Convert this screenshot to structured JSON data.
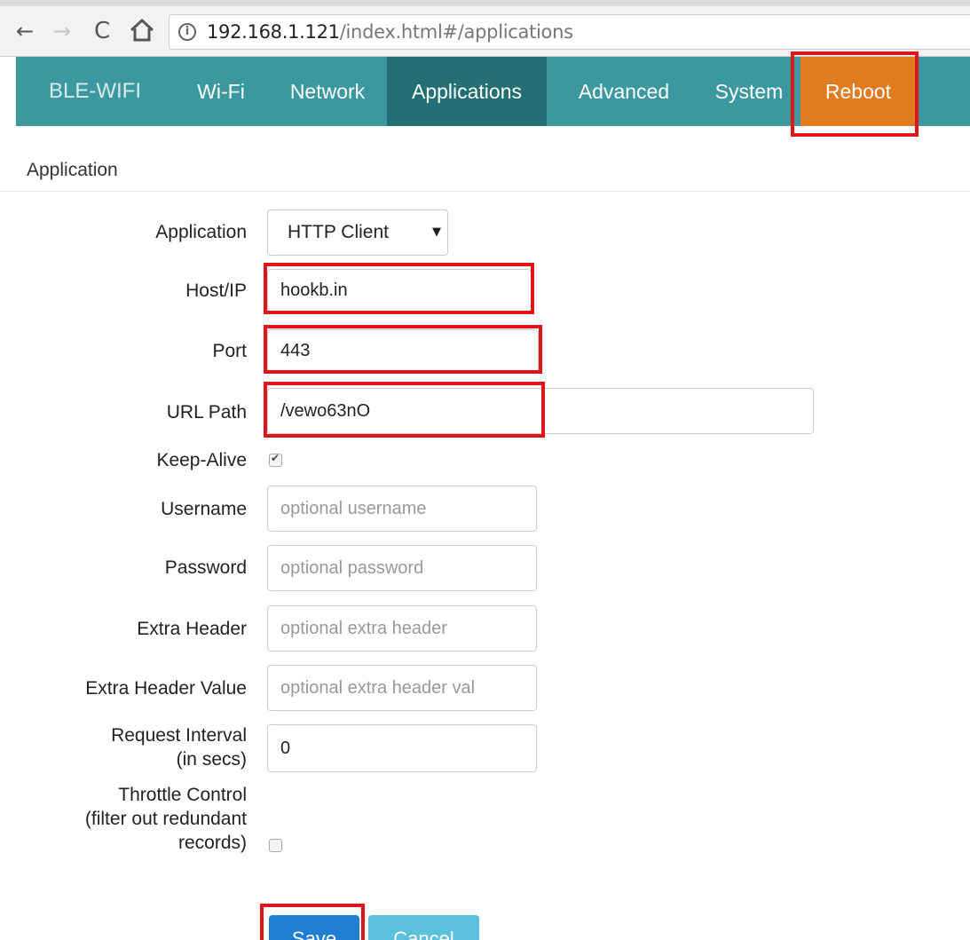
{
  "browser": {
    "back_glyph": "←",
    "forward_glyph": "→",
    "reload_glyph": "C",
    "info_glyph": "i",
    "url_host": "192.168.1.121",
    "url_path": "/index.html#/applications"
  },
  "navbar": {
    "brand": "BLE-WIFI",
    "items": [
      "Wi-Fi",
      "Network",
      "Applications",
      "Advanced",
      "System",
      "Reboot"
    ],
    "active_item": "Applications",
    "colors": {
      "bar": "#3b989e",
      "active": "#246f74",
      "reboot": "#e07b1f"
    }
  },
  "section_title": "Application",
  "form": {
    "application": {
      "label": "Application",
      "value": "HTTP Client",
      "arrow": "▼"
    },
    "host": {
      "label": "Host/IP",
      "value": "hookb.in"
    },
    "port": {
      "label": "Port",
      "value": "443"
    },
    "url_path": {
      "label": "URL Path",
      "value": "/vewo63nO"
    },
    "keep_alive": {
      "label": "Keep-Alive",
      "checked": true
    },
    "username": {
      "label": "Username",
      "placeholder": "optional username"
    },
    "password": {
      "label": "Password",
      "placeholder": "optional password"
    },
    "extra_header": {
      "label": "Extra Header",
      "placeholder": "optional extra header"
    },
    "extra_header_value": {
      "label": "Extra Header Value",
      "placeholder": "optional extra header val"
    },
    "request_interval": {
      "label_line1": "Request Interval",
      "label_line2": "(in secs)",
      "value": "0"
    },
    "throttle": {
      "label_line1": "Throttle Control",
      "label_line2": "(filter out redundant",
      "label_line3": "records)",
      "checked": false
    }
  },
  "buttons": {
    "save": "Save",
    "cancel": "Cancel"
  },
  "highlight_color": "#e0151a"
}
